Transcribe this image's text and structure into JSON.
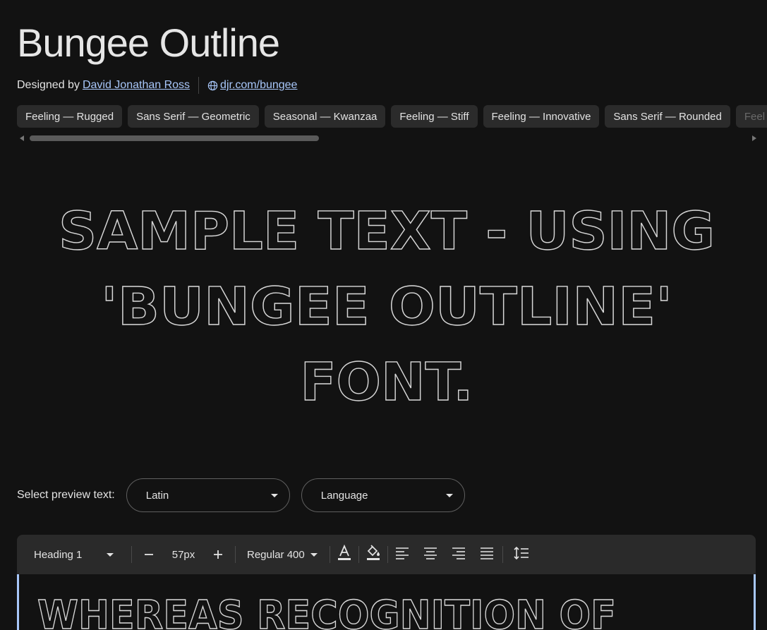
{
  "font": {
    "title": "Bungee Outline",
    "designed_by_prefix": "Designed by",
    "designer": "David Jonathan Ross",
    "website": "djr.com/bungee"
  },
  "tags": [
    "Feeling — Rugged",
    "Sans Serif — Geometric",
    "Seasonal — Kwanzaa",
    "Feeling — Stiff",
    "Feeling — Innovative",
    "Sans Serif — Rounded",
    "Feel"
  ],
  "sample": {
    "lines": [
      "SAMPLE TEXT - USING",
      "'BUNGEE OUTLINE'",
      "FONT."
    ]
  },
  "preview": {
    "label": "Select preview text:",
    "script_value": "Latin",
    "language_value": "Language"
  },
  "toolbar": {
    "style_value": "Heading 1",
    "size_value": "57px",
    "weight_value": "Regular 400"
  },
  "editor": {
    "text": "WHEREAS RECOGNITION OF"
  },
  "colors": {
    "background": "#121212",
    "link": "#a8c7fa",
    "chip": "#2b2b2b",
    "toolbar": "#2a2a2a"
  }
}
